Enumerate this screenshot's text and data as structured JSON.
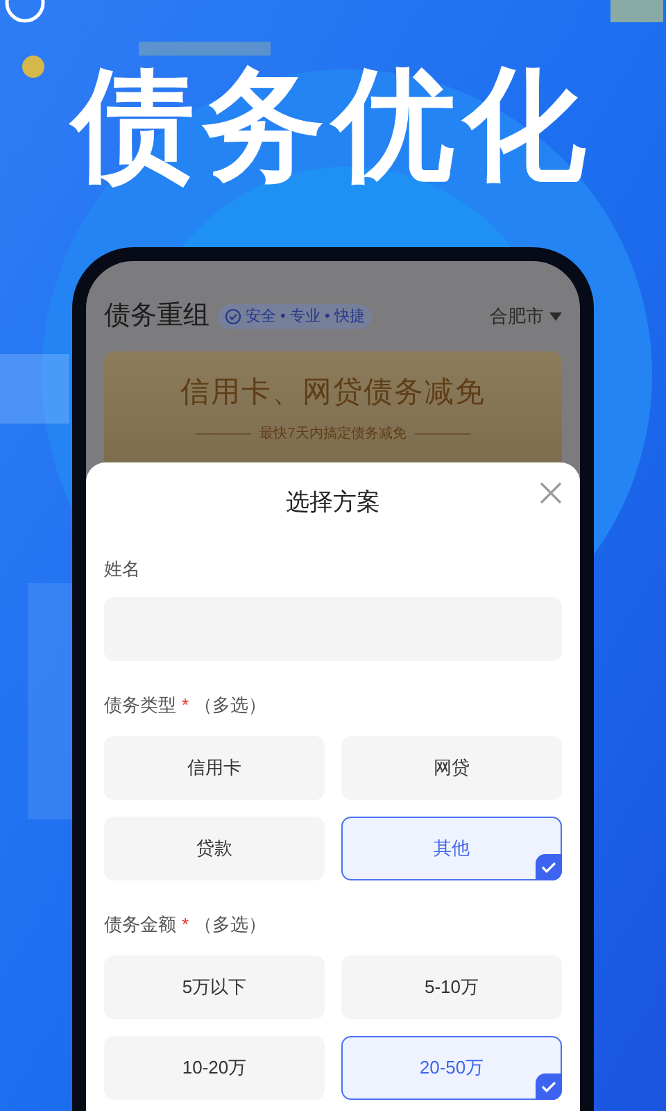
{
  "headline": "债务优化",
  "app_header": {
    "title": "债务重组",
    "badge": "安全 • 专业 • 快捷",
    "city": "合肥市"
  },
  "banner": {
    "title": "信用卡、网贷债务减免",
    "subtitle": "最快7天内搞定债务减免"
  },
  "sheet": {
    "title": "选择方案",
    "name_field": {
      "label": "姓名"
    },
    "groups": [
      {
        "label": "债务类型",
        "required_mark": "*",
        "note": "（多选）",
        "options": [
          {
            "label": "信用卡",
            "selected": false
          },
          {
            "label": "网贷",
            "selected": false
          },
          {
            "label": "贷款",
            "selected": false
          },
          {
            "label": "其他",
            "selected": true
          }
        ]
      },
      {
        "label": "债务金额",
        "required_mark": "*",
        "note": "（多选）",
        "options": [
          {
            "label": "5万以下",
            "selected": false
          },
          {
            "label": "5-10万",
            "selected": false
          },
          {
            "label": "10-20万",
            "selected": false
          },
          {
            "label": "20-50万",
            "selected": true
          }
        ]
      }
    ]
  }
}
